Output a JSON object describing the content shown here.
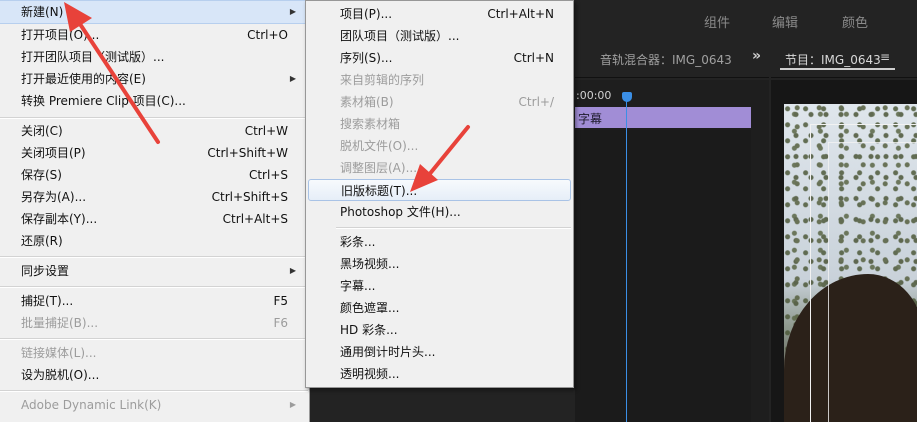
{
  "workspace": {
    "tabs": [
      "组件",
      "编辑",
      "颜色"
    ],
    "mixer_title": "音轨混合器：IMG_0643",
    "program_title": "节目：IMG_0643",
    "timecode": ":00:00",
    "clip_label": "字幕",
    "accent_color": "#3b8fe6",
    "clip_color": "#a18dd6"
  },
  "file_menu": {
    "items": [
      {
        "label": "新建(N)",
        "shortcut": "",
        "submenu": true,
        "disabled": false,
        "highlighted": true
      },
      {
        "label": "打开项目(O)...",
        "shortcut": "Ctrl+O",
        "submenu": false,
        "disabled": false
      },
      {
        "label": "打开团队项目（测试版）...",
        "shortcut": "",
        "submenu": false,
        "disabled": false
      },
      {
        "label": "打开最近使用的内容(E)",
        "shortcut": "",
        "submenu": true,
        "disabled": false
      },
      {
        "label": "转换 Premiere Clip 项目(C)...",
        "shortcut": "",
        "submenu": false,
        "disabled": false
      },
      {
        "label": "关闭(C)",
        "shortcut": "Ctrl+W",
        "submenu": false,
        "disabled": false
      },
      {
        "label": "关闭项目(P)",
        "shortcut": "Ctrl+Shift+W",
        "submenu": false,
        "disabled": false
      },
      {
        "label": "保存(S)",
        "shortcut": "Ctrl+S",
        "submenu": false,
        "disabled": false
      },
      {
        "label": "另存为(A)...",
        "shortcut": "Ctrl+Shift+S",
        "submenu": false,
        "disabled": false
      },
      {
        "label": "保存副本(Y)...",
        "shortcut": "Ctrl+Alt+S",
        "submenu": false,
        "disabled": false
      },
      {
        "label": "还原(R)",
        "shortcut": "",
        "submenu": false,
        "disabled": false
      },
      {
        "label": "同步设置",
        "shortcut": "",
        "submenu": true,
        "disabled": false
      },
      {
        "label": "捕捉(T)...",
        "shortcut": "F5",
        "submenu": false,
        "disabled": false
      },
      {
        "label": "批量捕捉(B)...",
        "shortcut": "F6",
        "submenu": false,
        "disabled": true
      },
      {
        "label": "链接媒体(L)...",
        "shortcut": "",
        "submenu": false,
        "disabled": true
      },
      {
        "label": "设为脱机(O)...",
        "shortcut": "",
        "submenu": false,
        "disabled": false
      },
      {
        "label": "Adobe Dynamic Link(K)",
        "shortcut": "",
        "submenu": true,
        "disabled": true
      }
    ]
  },
  "new_submenu": {
    "items": [
      {
        "label": "项目(P)...",
        "shortcut": "Ctrl+Alt+N",
        "disabled": false
      },
      {
        "label": "团队项目（测试版）...",
        "shortcut": "",
        "disabled": false
      },
      {
        "label": "序列(S)...",
        "shortcut": "Ctrl+N",
        "disabled": false
      },
      {
        "label": "来自剪辑的序列",
        "shortcut": "",
        "disabled": true
      },
      {
        "label": "素材箱(B)",
        "shortcut": "Ctrl+/",
        "disabled": true
      },
      {
        "label": "搜索素材箱",
        "shortcut": "",
        "disabled": true
      },
      {
        "label": "脱机文件(O)...",
        "shortcut": "",
        "disabled": true
      },
      {
        "label": "调整图层(A)...",
        "shortcut": "",
        "disabled": true
      },
      {
        "label": "旧版标题(T)...",
        "shortcut": "",
        "disabled": false,
        "highlighted": true
      },
      {
        "label": "Photoshop 文件(H)...",
        "shortcut": "",
        "disabled": false
      },
      {
        "label": "彩条...",
        "shortcut": "",
        "disabled": false
      },
      {
        "label": "黑场视频...",
        "shortcut": "",
        "disabled": false
      },
      {
        "label": "字幕...",
        "shortcut": "",
        "disabled": false
      },
      {
        "label": "颜色遮罩...",
        "shortcut": "",
        "disabled": false
      },
      {
        "label": "HD 彩条...",
        "shortcut": "",
        "disabled": false
      },
      {
        "label": "通用倒计时片头...",
        "shortcut": "",
        "disabled": false
      },
      {
        "label": "透明视频...",
        "shortcut": "",
        "disabled": false
      }
    ]
  },
  "annotation_color": "#e8423a"
}
